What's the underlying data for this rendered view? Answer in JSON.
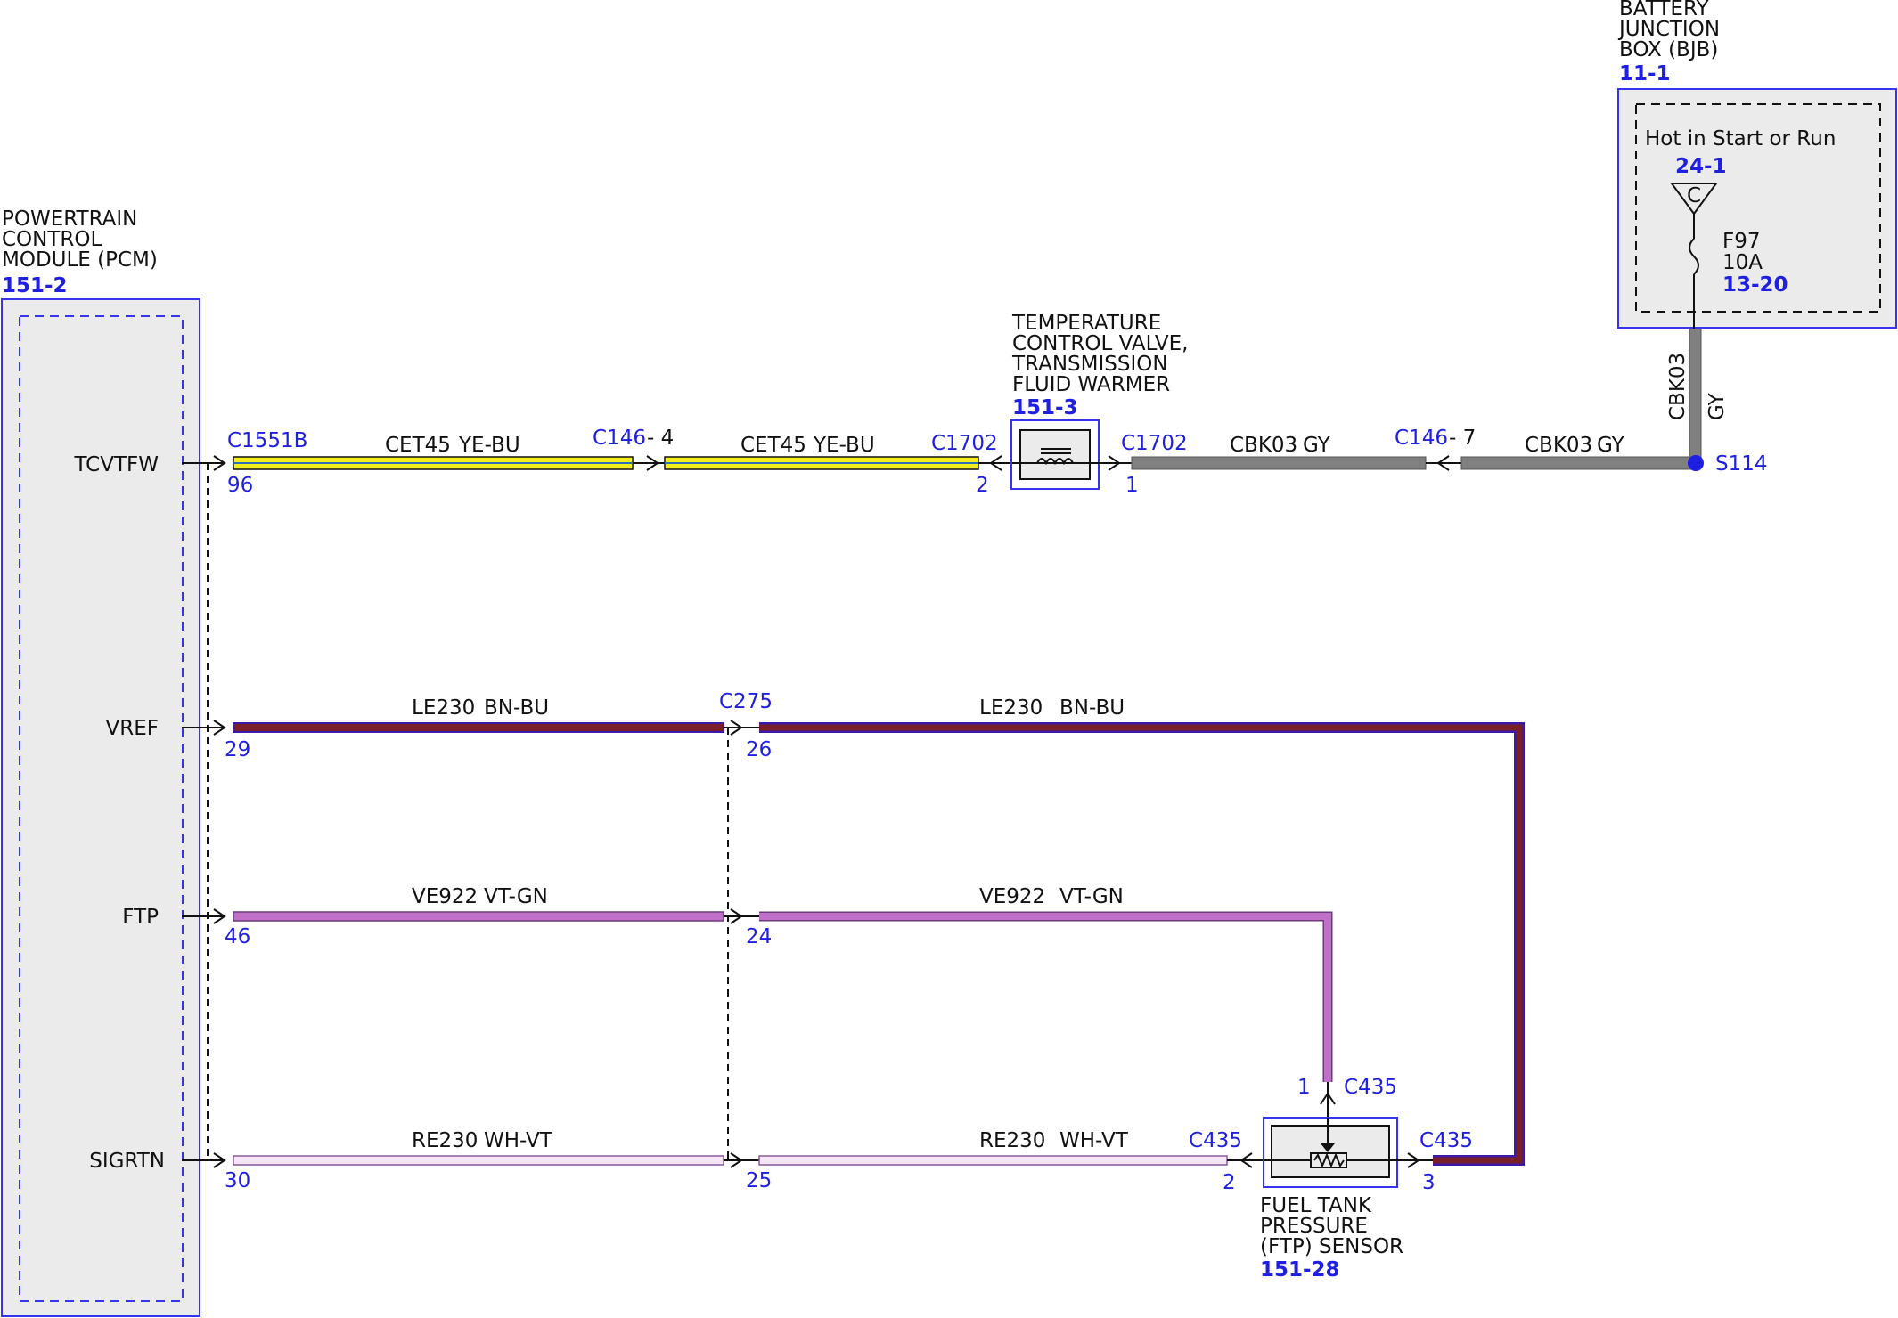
{
  "pcm": {
    "title_lines": [
      "POWERTRAIN",
      "CONTROL",
      "MODULE (PCM)"
    ],
    "ref": "151-2",
    "pins": [
      "TCVTFW",
      "VREF",
      "FTP",
      "SIGRTN"
    ]
  },
  "bjb": {
    "title_lines": [
      "BATTERY",
      "JUNCTION",
      "BOX (BJB)"
    ],
    "ref": "11-1",
    "hot_label": "Hot in Start or Run",
    "hot_ref": "24-1",
    "bus_letter": "C",
    "fuse_name": "F97",
    "fuse_rating": "10A",
    "fuse_ref": "13-20"
  },
  "tcv": {
    "title_lines": [
      "TEMPERATURE",
      "CONTROL VALVE,",
      "TRANSMISSION",
      "FLUID WARMER"
    ],
    "ref": "151-3"
  },
  "ftp_sensor": {
    "title_lines": [
      "FUEL TANK",
      "PRESSURE",
      "(FTP) SENSOR"
    ],
    "ref": "151-28"
  },
  "splice": {
    "name": "S114"
  },
  "vertical_wire": {
    "circuit": "CBK03",
    "color": "GY"
  },
  "connectors": {
    "c1551b": "C1551B",
    "c146_4": "C146",
    "c146_4_pin": "- 4",
    "c1702_left": "C1702",
    "c1702_right": "C1702",
    "c146_7": "C146",
    "c146_7_pin": "- 7",
    "c275": "C275",
    "c435_top": "C435",
    "c435_left": "C435",
    "c435_right": "C435"
  },
  "pins": {
    "p96": "96",
    "p2_tcv": "2",
    "p1_tcv": "1",
    "p29": "29",
    "p26": "26",
    "p46": "46",
    "p24": "24",
    "p30": "30",
    "p25": "25",
    "p1_ftp": "1",
    "p2_ftp": "2",
    "p3_ftp": "3"
  },
  "wires": {
    "tcv_a": {
      "circuit": "CET45",
      "color": "YE-BU"
    },
    "tcv_b": {
      "circuit": "CET45",
      "color": "YE-BU"
    },
    "bat_a": {
      "circuit": "CBK03",
      "color": "GY"
    },
    "bat_b": {
      "circuit": "CBK03",
      "color": "GY"
    },
    "vref_a": {
      "circuit": "LE230",
      "color": "BN-BU"
    },
    "vref_b": {
      "circuit": "LE230",
      "color": "BN-BU"
    },
    "ftp_a": {
      "circuit": "VE922",
      "color": "VT-GN"
    },
    "ftp_b": {
      "circuit": "VE922",
      "color": "VT-GN"
    },
    "sig_a": {
      "circuit": "RE230",
      "color": "WH-VT"
    },
    "sig_b": {
      "circuit": "RE230",
      "color": "WH-VT"
    }
  },
  "colors": {
    "label_blue": "#1f1fe0",
    "box_blue": "#3535ee",
    "wire_yellow": "#f2ee1a",
    "wire_gray": "#808080",
    "wire_brown": "#7a1f2a",
    "wire_purple": "#c070c8",
    "wire_white_violet": "#f4e6f6"
  }
}
